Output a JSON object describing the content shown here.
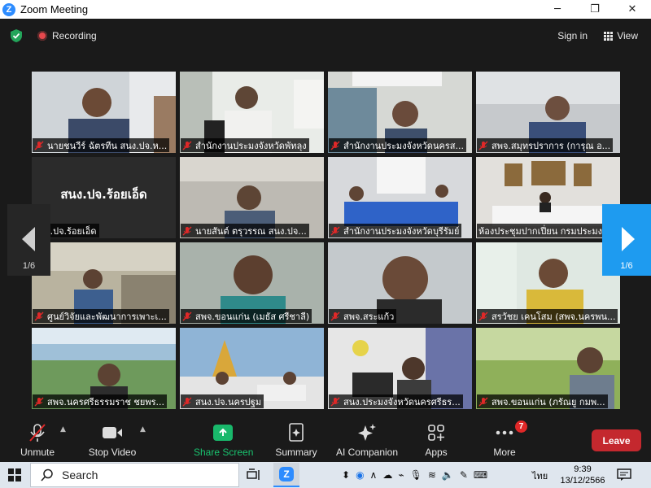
{
  "window": {
    "title": "Zoom Meeting"
  },
  "topbar": {
    "recording_label": "Recording",
    "signin_label": "Sign in",
    "view_label": "View"
  },
  "gallery": {
    "page_indicator_left": "1/6",
    "page_indicator_right": "1/6",
    "placeholder_name": "สนง.ปจ.ร้อยเอ็ด",
    "tiles": [
      {
        "name": "นายชนวีร์ ฉัตรทีน สนง.ปจ.ห...",
        "muted": true
      },
      {
        "name": "สำนักงานประมงจังหวัดพัทลุง",
        "muted": true
      },
      {
        "name": "สำนักงานประมงจังหวัดนครส...",
        "muted": true
      },
      {
        "name": "สพจ.สมุทรปราการ (การุณ อ...",
        "muted": true
      },
      {
        "name": "สนง.ปจ.ร้อยเอ็ด",
        "muted": false
      },
      {
        "name": "นายสันต์ ตรุวรรณ สนง.ปจ...",
        "muted": true
      },
      {
        "name": "สำนักงานประมงจังหวัดบุรีรัมย์",
        "muted": true
      },
      {
        "name": "ห้องประชุมปากเปี่ยน กรมประมง",
        "muted": false
      },
      {
        "name": "ศูนย์วิจัยและพัฒนาการเพาะเ...",
        "muted": true
      },
      {
        "name": "สพจ.ขอนแก่น (เมธัส ศรีชาลี)",
        "muted": true
      },
      {
        "name": "สพจ.สระแก้ว",
        "muted": true
      },
      {
        "name": "สรวัชย เคนโสม (สพจ.นครพน...",
        "muted": true
      },
      {
        "name": "สพจ.นครศรีธรรมราช ชยพร...",
        "muted": true
      },
      {
        "name": "สนง.ปจ.นครปฐม",
        "muted": true
      },
      {
        "name": "สนง.ประมงจังหวัดนครศรีธร...",
        "muted": true
      },
      {
        "name": "สพจ.ขอนแก่น (ภรัณยู กมพ...",
        "muted": true
      }
    ]
  },
  "toolbar": {
    "unmute_label": "Unmute",
    "stop_video_label": "Stop Video",
    "share_screen_label": "Share Screen",
    "summary_label": "Summary",
    "ai_companion_label": "AI Companion",
    "apps_label": "Apps",
    "more_label": "More",
    "more_badge": "7",
    "leave_label": "Leave",
    "share_color": "#19b86b",
    "leave_color": "#c4282e"
  },
  "taskbar": {
    "search_placeholder": "Search",
    "language": "ไทย",
    "time": "9:39",
    "date": "13/12/2566"
  }
}
